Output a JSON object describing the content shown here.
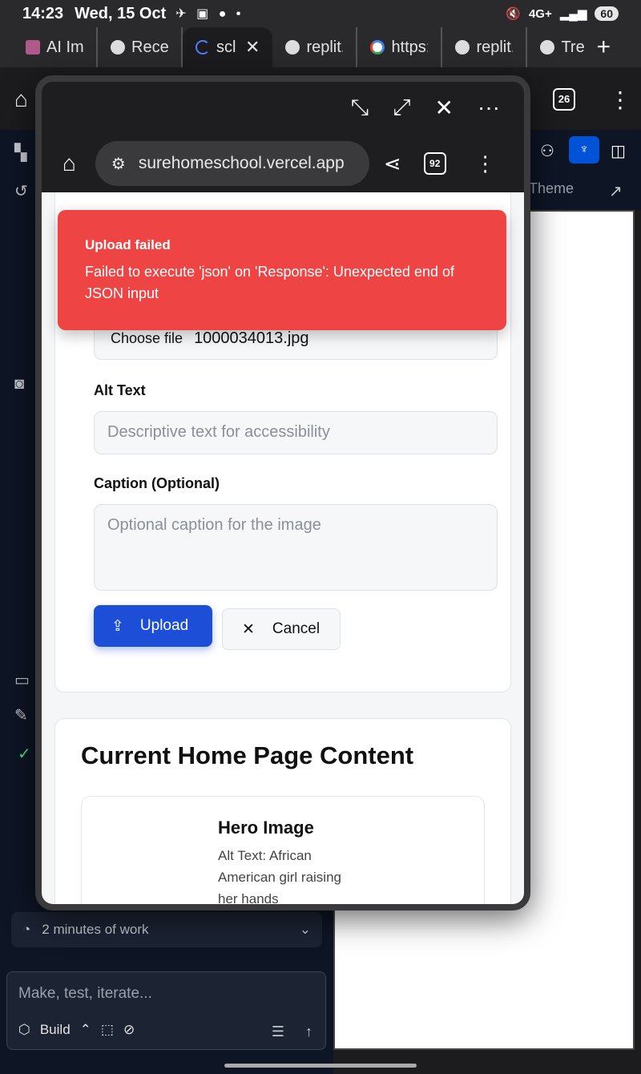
{
  "status_bar": {
    "time": "14:23",
    "date": "Wed, 15 Oct",
    "battery": "60",
    "network": "4G+"
  },
  "tabs": [
    {
      "title": "AI Ima"
    },
    {
      "title": "Recer"
    },
    {
      "title": "scl"
    },
    {
      "title": "replit."
    },
    {
      "title": "https:"
    },
    {
      "title": "replit."
    },
    {
      "title": "Trea"
    }
  ],
  "background_app": {
    "tab_count": "26",
    "theme_label": "Theme",
    "work_summary": "2 minutes of work",
    "prompt_placeholder": "Make, test, iterate...",
    "build_label": "Build"
  },
  "popup": {
    "url": "surehomeschool.vercel.app",
    "tab_count": "92"
  },
  "toast": {
    "title": "Upload failed",
    "message": "Failed to execute 'json' on 'Response': Unexpected end of JSON input"
  },
  "form": {
    "choose_file_label": "Choose file",
    "file_name": "1000034013.jpg",
    "alt_text_label": "Alt Text",
    "alt_text_placeholder": "Descriptive text for accessibility",
    "caption_label": "Caption (Optional)",
    "caption_placeholder": "Optional caption for the image",
    "upload_label": "Upload",
    "cancel_label": "Cancel"
  },
  "content": {
    "title": "Current Home Page Content",
    "hero_title": "Hero Image",
    "hero_alt": "Alt Text: African American girl raising her hands"
  },
  "colors": {
    "toast_bg": "#ef4444",
    "primary_button": "#1d4ed8",
    "replit_blue": "#0053d6"
  }
}
